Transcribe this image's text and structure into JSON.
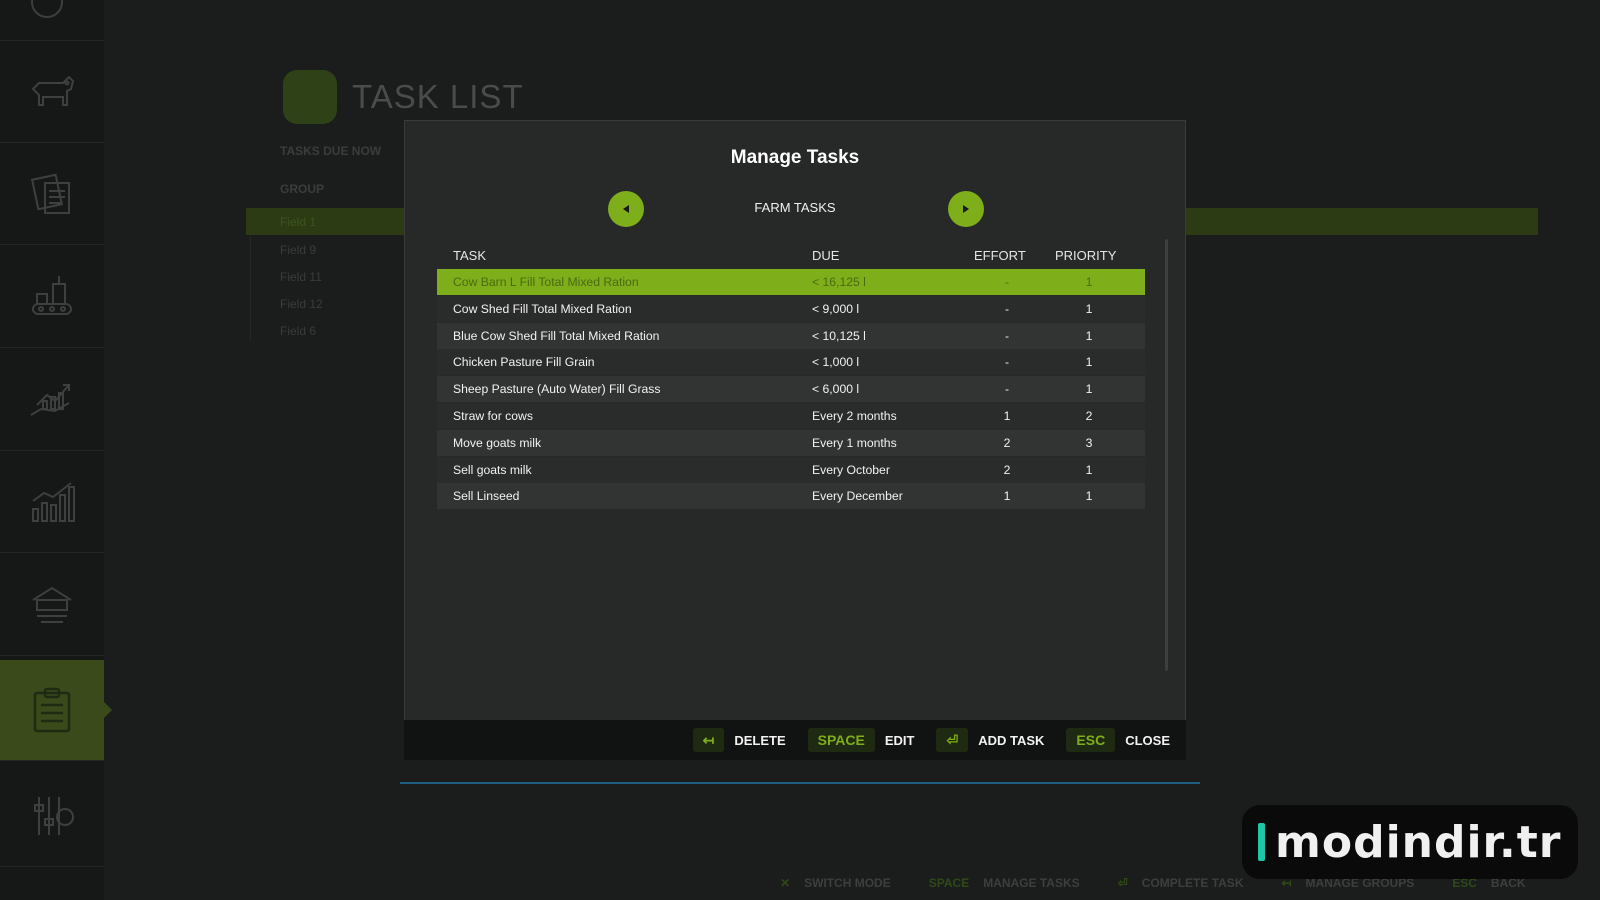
{
  "background_page": {
    "title": "TASK LIST",
    "tasks_due_now_label": "TASKS DUE NOW",
    "group_label": "GROUP",
    "highlighted_row": "Field 1",
    "fields": [
      "Field 9",
      "Field 11",
      "Field 12",
      "Field 6"
    ]
  },
  "dialog": {
    "title": "Manage Tasks",
    "group_name": "FARM TASKS",
    "columns": {
      "task": "TASK",
      "due": "DUE",
      "effort": "EFFORT",
      "priority": "PRIORITY"
    },
    "rows": [
      {
        "task": "Cow Barn L Fill Total Mixed Ration",
        "due": "< 16,125 l",
        "effort": "-",
        "priority": "1"
      },
      {
        "task": "Cow Shed Fill Total Mixed Ration",
        "due": "< 9,000 l",
        "effort": "-",
        "priority": "1"
      },
      {
        "task": "Blue Cow Shed Fill Total Mixed Ration",
        "due": "< 10,125 l",
        "effort": "-",
        "priority": "1"
      },
      {
        "task": "Chicken Pasture Fill Grain",
        "due": "< 1,000 l",
        "effort": "-",
        "priority": "1"
      },
      {
        "task": "Sheep Pasture (Auto Water) Fill Grass",
        "due": "< 6,000 l",
        "effort": "-",
        "priority": "1"
      },
      {
        "task": "Straw for cows",
        "due": "Every 2 months",
        "effort": "1",
        "priority": "2"
      },
      {
        "task": "Move goats milk",
        "due": "Every 1 months",
        "effort": "2",
        "priority": "3"
      },
      {
        "task": "Sell goats milk",
        "due": "Every October",
        "effort": "2",
        "priority": "1"
      },
      {
        "task": "Sell Linseed",
        "due": "Every December",
        "effort": "1",
        "priority": "1"
      }
    ],
    "selected_row": 0
  },
  "footer": {
    "delete_key": "↤",
    "delete_label": "DELETE",
    "edit_key": "SPACE",
    "edit_label": "EDIT",
    "add_key": "⏎",
    "add_label": "ADD TASK",
    "close_key": "ESC",
    "close_label": "CLOSE"
  },
  "bottom_hints": {
    "switch_mode": "SWITCH MODE",
    "space_key": "SPACE",
    "manage_tasks": "MANAGE TASKS",
    "complete_task": "COMPLETE TASK",
    "manage_groups": "MANAGE GROUPS",
    "esc_key": "ESC",
    "back": "BACK"
  },
  "watermark": "modindir.tr",
  "colors": {
    "accent": "#7fae1b",
    "background": "#1b1c1c",
    "dialog": "#272828"
  },
  "sidebar_icons": [
    "cow-icon",
    "documents-icon",
    "production-icon",
    "finance-icon",
    "statistics-icon",
    "garage-icon",
    "task-list-icon",
    "settings-icon"
  ]
}
